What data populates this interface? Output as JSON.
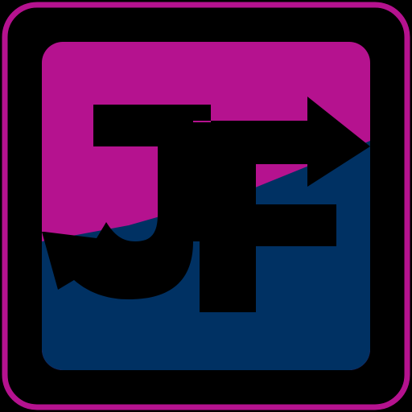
{
  "logo": {
    "text": "JF",
    "description_icon": "jf-logo-icon",
    "colors": {
      "background": "#000000",
      "frame": "#B5128F",
      "top_panel": "#B5128F",
      "bottom_panel": "#003163",
      "glyphs": "#000000"
    }
  }
}
